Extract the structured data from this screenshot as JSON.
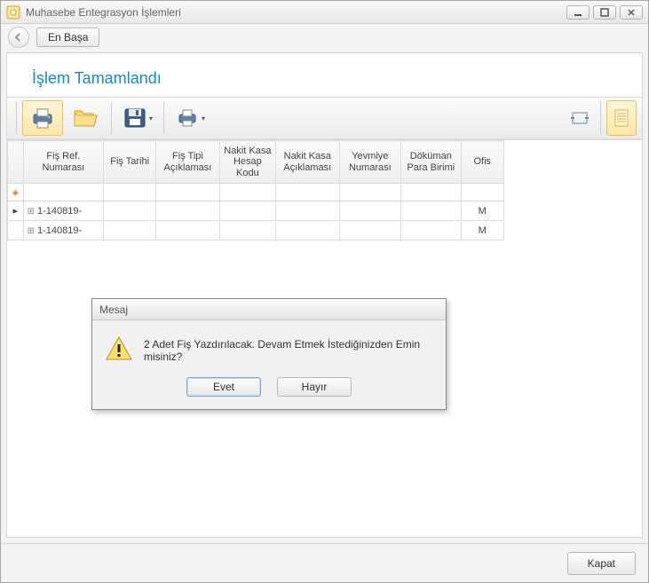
{
  "window": {
    "title": "Muhasebe Entegrasyon İşlemleri"
  },
  "nav": {
    "top_button": "En Başa"
  },
  "heading": "İşlem Tamamlandı",
  "toolbar": {
    "icons": {
      "print": "print-icon",
      "open": "folder-open-icon",
      "save": "save-icon",
      "print2": "print-icon",
      "fit": "fit-width-icon",
      "page": "page-icon"
    }
  },
  "grid": {
    "columns": [
      "Fiş Ref. Numarası",
      "Fiş Tarihi",
      "Fiş Tipi Açıklaması",
      "Nakit Kasa Hesap Kodu",
      "Nakit Kasa Açıklaması",
      "Yevmiye Numarası",
      "Döküman Para Birimi",
      "Ofis"
    ],
    "rows": [
      {
        "ref": "1-140819-",
        "ofis": "M"
      },
      {
        "ref": "1-140819-",
        "ofis": "M"
      }
    ]
  },
  "dialog": {
    "title": "Mesaj",
    "message": "2 Adet Fiş Yazdırılacak. Devam Etmek İstediğinizden Emin misiniz?",
    "yes": "Evet",
    "no": "Hayır"
  },
  "footer": {
    "close": "Kapat"
  }
}
